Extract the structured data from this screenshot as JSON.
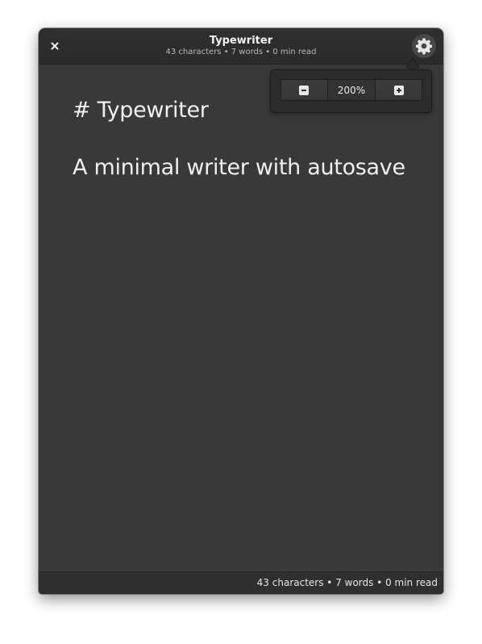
{
  "window": {
    "title": "Typewriter",
    "subtitle": "43 characters • 7 words • 0 min read"
  },
  "editor": {
    "lines": [
      "# Typewriter",
      "A minimal writer with autosave"
    ]
  },
  "statusbar": {
    "text": "43 characters • 7 words • 0 min read"
  },
  "zoom_popover": {
    "zoom_value": "200%"
  },
  "icons": {
    "close": "close-icon",
    "settings": "gear-icon",
    "zoom_out": "minus-icon",
    "zoom_in": "plus-icon"
  },
  "colors": {
    "window_bg": "#393939",
    "titlebar_bg": "#2d2d2d",
    "text": "#efefef"
  }
}
